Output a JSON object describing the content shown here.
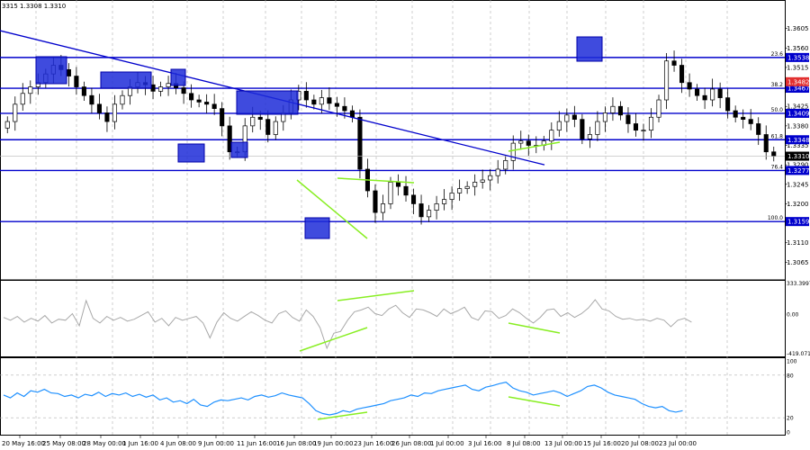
{
  "header": {
    "ohlc_text": "3315 1.3308 1.3310"
  },
  "chart_data": {
    "type": "candlestick",
    "instrument_readout": "3315 1.3308 1.3310",
    "price_axis": {
      "ticks": [
        "1.3605",
        "1.3560",
        "1.3515",
        "1.3470",
        "1.3425",
        "1.3380",
        "1.3335",
        "1.3290",
        "1.3245",
        "1.3200",
        "1.3155",
        "1.3110",
        "1.3065"
      ],
      "range": [
        1.3045,
        1.365
      ]
    },
    "time_axis": {
      "labels": [
        "20 May 16:00",
        "25 May 08:00",
        "28 May 00:00",
        "1 Jun 16:00",
        "4 Jun 08:00",
        "9 Jun 00:00",
        "11 Jun 16:00",
        "16 Jun 08:00",
        "19 Jun 00:00",
        "23 Jun 16:00",
        "26 Jun 08:00",
        "1 Jul 00:00",
        "3 Jul 16:00",
        "8 Jul 08:00",
        "13 Jul 00:00",
        "15 Jul 16:00",
        "20 Jul 08:00",
        "23 Jul 00:00"
      ]
    },
    "fibonacci_levels": [
      {
        "label": "23.6",
        "price": 1.3538,
        "price_text": "1.3538"
      },
      {
        "label": "38.2",
        "price": 1.3467,
        "price_text": "1.3467"
      },
      {
        "label": "50.0",
        "price": 1.3409,
        "price_text": "1.3409"
      },
      {
        "label": "61.8",
        "price": 1.3348,
        "price_text": "1.3348"
      },
      {
        "label": "76.4",
        "price": 1.3277,
        "price_text": "1.3277"
      },
      {
        "label": "100.0",
        "price": 1.3159,
        "price_text": "1.3159"
      }
    ],
    "price_markers": [
      {
        "price": 1.3482,
        "text": "1.3482",
        "color": "#e23030"
      },
      {
        "price": 1.331,
        "text": "1.3310",
        "color": "#000000"
      }
    ],
    "close_series": [
      1.339,
      1.343,
      1.3455,
      1.347,
      1.348,
      1.35,
      1.352,
      1.351,
      1.3495,
      1.347,
      1.345,
      1.343,
      1.341,
      1.339,
      1.343,
      1.345,
      1.347,
      1.348,
      1.3475,
      1.346,
      1.347,
      1.3478,
      1.3468,
      1.3455,
      1.344,
      1.3435,
      1.343,
      1.342,
      1.338,
      1.332,
      1.332,
      1.338,
      1.34,
      1.3395,
      1.336,
      1.339,
      1.341,
      1.344,
      1.346,
      1.344,
      1.343,
      1.3445,
      1.3432,
      1.3425,
      1.3415,
      1.34,
      1.328,
      1.323,
      1.318,
      1.32,
      1.325,
      1.324,
      1.322,
      1.32,
      1.317,
      1.3185,
      1.32,
      1.321,
      1.3225,
      1.3235,
      1.324,
      1.325,
      1.3255,
      1.3265,
      1.328,
      1.33,
      1.334,
      1.3345,
      1.3335,
      1.3335,
      1.3345,
      1.337,
      1.339,
      1.3405,
      1.3395,
      1.335,
      1.336,
      1.339,
      1.341,
      1.3425,
      1.3405,
      1.3385,
      1.337,
      1.337,
      1.34,
      1.344,
      1.353,
      1.352,
      1.348,
      1.3465,
      1.345,
      1.344,
      1.3465,
      1.3445,
      1.3415,
      1.34,
      1.3395,
      1.3385,
      1.336,
      1.332,
      1.331
    ],
    "trendlines": [
      {
        "name": "downtrend",
        "color": "#0000cc"
      },
      {
        "name": "divergence",
        "color": "#88ee22"
      }
    ],
    "cci": {
      "max_label": "333.3997",
      "zero_label": "0.00",
      "min_label": "-419.071",
      "range": [
        -419.071,
        333.3997
      ],
      "values": [
        -30,
        -60,
        -20,
        -80,
        -40,
        -70,
        -10,
        -90,
        -50,
        -60,
        10,
        -120,
        150,
        -40,
        -90,
        -20,
        -60,
        -30,
        -70,
        -50,
        -10,
        30,
        -80,
        -40,
        -120,
        -30,
        -60,
        -40,
        -20,
        -90,
        -250,
        -80,
        20,
        -40,
        -70,
        -20,
        30,
        -10,
        -60,
        -90,
        10,
        40,
        -30,
        -70,
        50,
        -20,
        -140,
        -360,
        -200,
        -180,
        -60,
        30,
        50,
        80,
        10,
        -10,
        60,
        100,
        20,
        -30,
        60,
        50,
        20,
        -20,
        60,
        10,
        40,
        80,
        -30,
        -60,
        40,
        30,
        -40,
        -10,
        60,
        20,
        -40,
        -90,
        -30,
        50,
        60,
        -20,
        20,
        -30,
        10,
        70,
        160,
        60,
        40,
        -20,
        -50,
        -40,
        -60,
        -50,
        -70,
        -40,
        -60,
        -130,
        -60,
        -40,
        -80
      ]
    },
    "rsi": {
      "ticks": [
        "100",
        "80",
        "20",
        "0"
      ],
      "range": [
        0,
        100
      ],
      "values": [
        52,
        48,
        55,
        50,
        58,
        56,
        60,
        55,
        54,
        50,
        52,
        48,
        53,
        51,
        56,
        50,
        54,
        52,
        55,
        50,
        53,
        49,
        52,
        45,
        48,
        42,
        44,
        40,
        46,
        38,
        36,
        42,
        45,
        44,
        46,
        48,
        45,
        50,
        52,
        49,
        51,
        55,
        52,
        50,
        48,
        40,
        30,
        26,
        24,
        26,
        30,
        28,
        32,
        34,
        36,
        38,
        40,
        44,
        46,
        48,
        52,
        50,
        55,
        54,
        58,
        60,
        62,
        64,
        66,
        60,
        58,
        63,
        65,
        68,
        70,
        62,
        58,
        56,
        52,
        54,
        56,
        58,
        55,
        50,
        54,
        58,
        64,
        66,
        62,
        56,
        52,
        50,
        48,
        46,
        40,
        36,
        34,
        36,
        30,
        28,
        30
      ]
    }
  }
}
